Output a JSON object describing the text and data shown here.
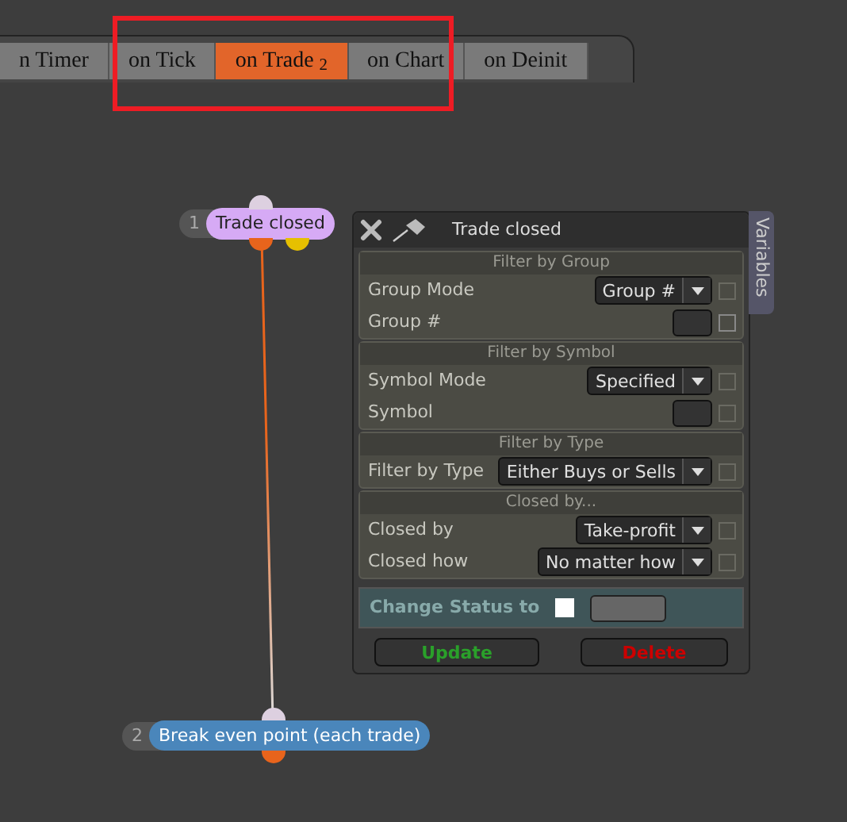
{
  "tabs": [
    {
      "label": "n Timer",
      "selected": false
    },
    {
      "label": "on Tick",
      "selected": false
    },
    {
      "label": "on Trade $_{2}$",
      "selected": true
    },
    {
      "label": "on Chart",
      "selected": false
    },
    {
      "label": "on Deinit",
      "selected": false
    }
  ],
  "nodes": [
    {
      "number": "1",
      "label": "Trade closed",
      "color": "#d6aaf5"
    },
    {
      "number": "2",
      "label": "Break even point (each trade)",
      "color": "#4a86bb"
    }
  ],
  "panel": {
    "title": "Trade closed",
    "side_tab": "Variables",
    "sections": [
      {
        "title": "Filter by Group",
        "rows": [
          {
            "label": "Group Mode",
            "kind": "dropdown",
            "value": "Group #",
            "checked": false
          },
          {
            "label": "Group #",
            "kind": "field",
            "checked": false
          }
        ]
      },
      {
        "title": "Filter by Symbol",
        "rows": [
          {
            "label": "Symbol Mode",
            "kind": "dropdown",
            "value": "Specified",
            "checked": false
          },
          {
            "label": "Symbol",
            "kind": "field",
            "checked": false
          }
        ]
      },
      {
        "title": "Filter by Type",
        "rows": [
          {
            "label": "Filter by Type",
            "kind": "dropdown",
            "value": "Either Buys or Sells",
            "checked": false
          }
        ]
      },
      {
        "title": "Closed by...",
        "rows": [
          {
            "label": "Closed by",
            "kind": "dropdown",
            "value": "Take-profit",
            "checked": false
          },
          {
            "label": "Closed how",
            "kind": "dropdown",
            "value": "No matter how",
            "checked": false
          }
        ]
      }
    ],
    "change_status": {
      "label": "Change Status to",
      "checked": false
    },
    "buttons": [
      {
        "label": "Update",
        "color": "#2aa02a"
      },
      {
        "label": "Delete",
        "color": "#cc0000"
      }
    ]
  }
}
